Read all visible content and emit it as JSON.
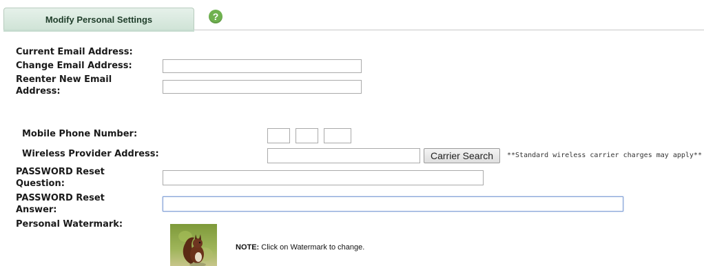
{
  "tab": {
    "label": "Modify Personal Settings",
    "help_icon": "?"
  },
  "labels": {
    "current_email": "Current Email Address:",
    "change_email": "Change Email Address:",
    "reenter_email": "Reenter New Email Address:",
    "mobile_phone": "Mobile Phone Number:",
    "wireless_provider": "Wireless Provider Address:",
    "password_question": "PASSWORD Reset Question:",
    "password_answer": "PASSWORD Reset Answer:",
    "watermark": "Personal Watermark:"
  },
  "fields": {
    "change_email": "",
    "reenter_email": "",
    "phone_area": "",
    "phone_prefix": "",
    "phone_line": "",
    "wireless_provider": "",
    "password_question": "",
    "password_answer": ""
  },
  "buttons": {
    "carrier_search": "Carrier Search"
  },
  "notes": {
    "carrier_charges": "**Standard wireless carrier charges may apply**",
    "watermark_note_bold": "NOTE:",
    "watermark_note_text": " Click on Watermark to change."
  },
  "colors": {
    "tab_bg": "#d8e9de",
    "help_icon": "#6fb14f",
    "focus_border": "#7f9fd6"
  },
  "icons": {
    "help": "question-circle-icon",
    "watermark": "squirrel-image"
  }
}
